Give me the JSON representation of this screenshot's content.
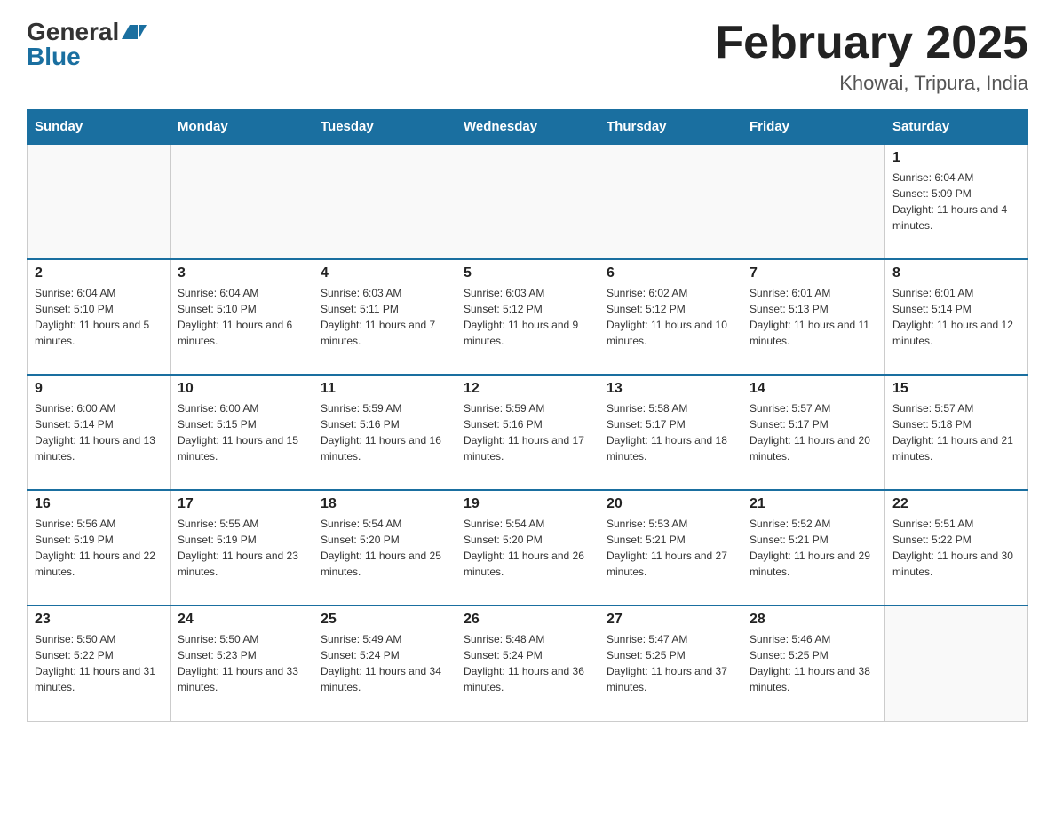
{
  "header": {
    "logo_general": "General",
    "logo_blue": "Blue",
    "month_title": "February 2025",
    "location": "Khowai, Tripura, India"
  },
  "days_of_week": [
    "Sunday",
    "Monday",
    "Tuesday",
    "Wednesday",
    "Thursday",
    "Friday",
    "Saturday"
  ],
  "weeks": [
    {
      "days": [
        {
          "date": "",
          "info": ""
        },
        {
          "date": "",
          "info": ""
        },
        {
          "date": "",
          "info": ""
        },
        {
          "date": "",
          "info": ""
        },
        {
          "date": "",
          "info": ""
        },
        {
          "date": "",
          "info": ""
        },
        {
          "date": "1",
          "info": "Sunrise: 6:04 AM\nSunset: 5:09 PM\nDaylight: 11 hours and 4 minutes."
        }
      ]
    },
    {
      "days": [
        {
          "date": "2",
          "info": "Sunrise: 6:04 AM\nSunset: 5:10 PM\nDaylight: 11 hours and 5 minutes."
        },
        {
          "date": "3",
          "info": "Sunrise: 6:04 AM\nSunset: 5:10 PM\nDaylight: 11 hours and 6 minutes."
        },
        {
          "date": "4",
          "info": "Sunrise: 6:03 AM\nSunset: 5:11 PM\nDaylight: 11 hours and 7 minutes."
        },
        {
          "date": "5",
          "info": "Sunrise: 6:03 AM\nSunset: 5:12 PM\nDaylight: 11 hours and 9 minutes."
        },
        {
          "date": "6",
          "info": "Sunrise: 6:02 AM\nSunset: 5:12 PM\nDaylight: 11 hours and 10 minutes."
        },
        {
          "date": "7",
          "info": "Sunrise: 6:01 AM\nSunset: 5:13 PM\nDaylight: 11 hours and 11 minutes."
        },
        {
          "date": "8",
          "info": "Sunrise: 6:01 AM\nSunset: 5:14 PM\nDaylight: 11 hours and 12 minutes."
        }
      ]
    },
    {
      "days": [
        {
          "date": "9",
          "info": "Sunrise: 6:00 AM\nSunset: 5:14 PM\nDaylight: 11 hours and 13 minutes."
        },
        {
          "date": "10",
          "info": "Sunrise: 6:00 AM\nSunset: 5:15 PM\nDaylight: 11 hours and 15 minutes."
        },
        {
          "date": "11",
          "info": "Sunrise: 5:59 AM\nSunset: 5:16 PM\nDaylight: 11 hours and 16 minutes."
        },
        {
          "date": "12",
          "info": "Sunrise: 5:59 AM\nSunset: 5:16 PM\nDaylight: 11 hours and 17 minutes."
        },
        {
          "date": "13",
          "info": "Sunrise: 5:58 AM\nSunset: 5:17 PM\nDaylight: 11 hours and 18 minutes."
        },
        {
          "date": "14",
          "info": "Sunrise: 5:57 AM\nSunset: 5:17 PM\nDaylight: 11 hours and 20 minutes."
        },
        {
          "date": "15",
          "info": "Sunrise: 5:57 AM\nSunset: 5:18 PM\nDaylight: 11 hours and 21 minutes."
        }
      ]
    },
    {
      "days": [
        {
          "date": "16",
          "info": "Sunrise: 5:56 AM\nSunset: 5:19 PM\nDaylight: 11 hours and 22 minutes."
        },
        {
          "date": "17",
          "info": "Sunrise: 5:55 AM\nSunset: 5:19 PM\nDaylight: 11 hours and 23 minutes."
        },
        {
          "date": "18",
          "info": "Sunrise: 5:54 AM\nSunset: 5:20 PM\nDaylight: 11 hours and 25 minutes."
        },
        {
          "date": "19",
          "info": "Sunrise: 5:54 AM\nSunset: 5:20 PM\nDaylight: 11 hours and 26 minutes."
        },
        {
          "date": "20",
          "info": "Sunrise: 5:53 AM\nSunset: 5:21 PM\nDaylight: 11 hours and 27 minutes."
        },
        {
          "date": "21",
          "info": "Sunrise: 5:52 AM\nSunset: 5:21 PM\nDaylight: 11 hours and 29 minutes."
        },
        {
          "date": "22",
          "info": "Sunrise: 5:51 AM\nSunset: 5:22 PM\nDaylight: 11 hours and 30 minutes."
        }
      ]
    },
    {
      "days": [
        {
          "date": "23",
          "info": "Sunrise: 5:50 AM\nSunset: 5:22 PM\nDaylight: 11 hours and 31 minutes."
        },
        {
          "date": "24",
          "info": "Sunrise: 5:50 AM\nSunset: 5:23 PM\nDaylight: 11 hours and 33 minutes."
        },
        {
          "date": "25",
          "info": "Sunrise: 5:49 AM\nSunset: 5:24 PM\nDaylight: 11 hours and 34 minutes."
        },
        {
          "date": "26",
          "info": "Sunrise: 5:48 AM\nSunset: 5:24 PM\nDaylight: 11 hours and 36 minutes."
        },
        {
          "date": "27",
          "info": "Sunrise: 5:47 AM\nSunset: 5:25 PM\nDaylight: 11 hours and 37 minutes."
        },
        {
          "date": "28",
          "info": "Sunrise: 5:46 AM\nSunset: 5:25 PM\nDaylight: 11 hours and 38 minutes."
        },
        {
          "date": "",
          "info": ""
        }
      ]
    }
  ]
}
